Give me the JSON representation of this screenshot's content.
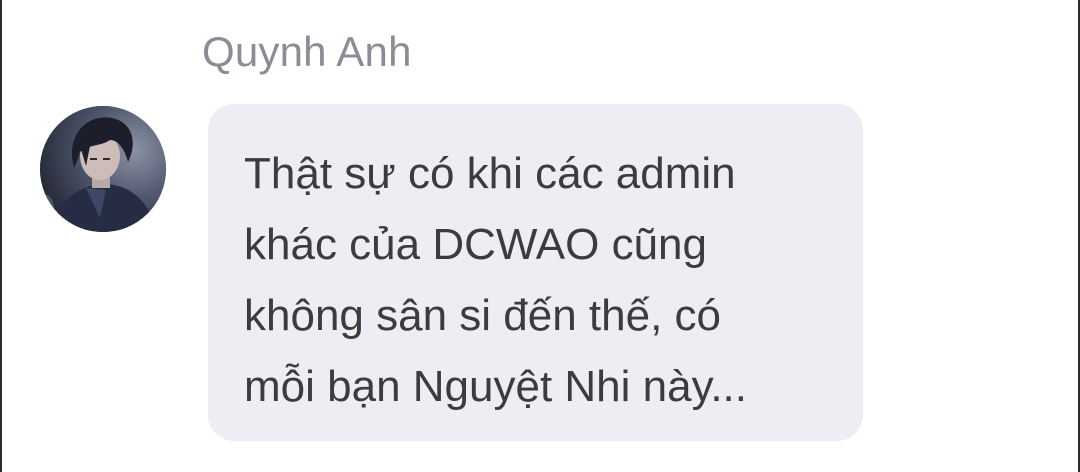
{
  "message": {
    "sender_name": "Quynh Anh",
    "text": "Thật sự có khi các admin\nkhác của DCWAO cũng\nkhông sân si đến thế, có\nmỗi bạn Nguyệt Nhi này..."
  },
  "avatar": {
    "icon": "user-avatar-photo"
  },
  "colors": {
    "background": "#ffffff",
    "bubble": "#ededf3",
    "sender_name": "#8a8d96",
    "message_text": "#3c3c3c"
  }
}
